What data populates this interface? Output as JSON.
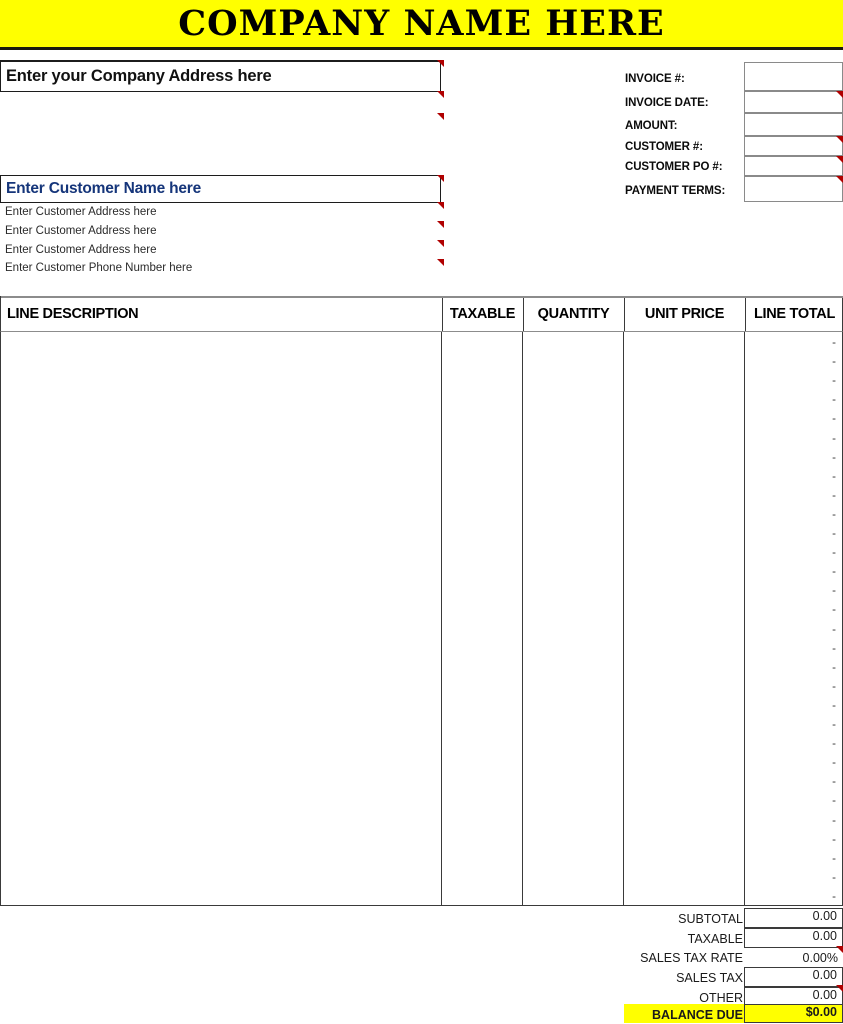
{
  "document": {
    "type": "invoice-template",
    "title": "COMPANY NAME HERE",
    "accent_yellow": "#FFFF00",
    "customer_name_color": "#15357A",
    "comment_marker_color": "#B00000"
  },
  "company": {
    "address_placeholder": "Enter your Company Address here"
  },
  "customer": {
    "name_placeholder": "Enter Customer Name here",
    "address_lines": [
      "Enter Customer Address here",
      "Enter Customer Address here",
      "Enter Customer Address here",
      "Enter Customer Phone Number here"
    ]
  },
  "meta_fields": [
    {
      "label": "INVOICE #:",
      "value": ""
    },
    {
      "label": "INVOICE DATE:",
      "value": ""
    },
    {
      "label": "AMOUNT:",
      "value": ""
    },
    {
      "label": "CUSTOMER #:",
      "value": ""
    },
    {
      "label": "CUSTOMER PO #:",
      "value": ""
    },
    {
      "label": "PAYMENT TERMS:",
      "value": ""
    }
  ],
  "line_items": {
    "columns": [
      "LINE DESCRIPTION",
      "TAXABLE",
      "QUANTITY",
      "UNIT PRICE",
      "LINE TOTAL"
    ],
    "row_count": 30,
    "empty_total_marker": "-"
  },
  "totals": [
    {
      "label": "SUBTOTAL",
      "value": "0.00",
      "boxed": true,
      "highlight": false,
      "bold": false
    },
    {
      "label": "TAXABLE",
      "value": "0.00",
      "boxed": true,
      "highlight": false,
      "bold": false
    },
    {
      "label": "SALES TAX RATE",
      "value": "0.00%",
      "boxed": false,
      "highlight": false,
      "bold": false
    },
    {
      "label": "SALES TAX",
      "value": "0.00",
      "boxed": true,
      "highlight": false,
      "bold": false
    },
    {
      "label": "OTHER",
      "value": "0.00",
      "boxed": true,
      "highlight": false,
      "bold": false
    },
    {
      "label": "BALANCE DUE",
      "value": "$0.00",
      "boxed": true,
      "highlight": true,
      "bold": true
    }
  ]
}
